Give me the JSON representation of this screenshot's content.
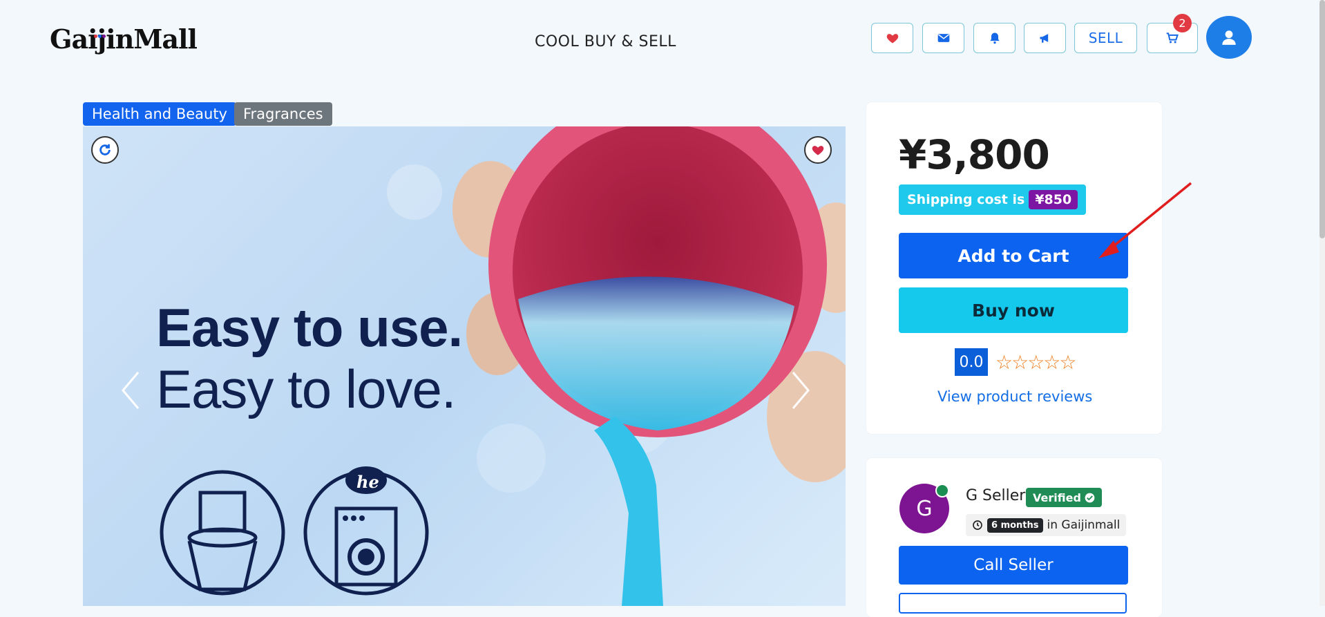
{
  "header": {
    "logo": "GaijinMall",
    "tagline": "COOL BUY & SELL",
    "sell_label": "SELL",
    "cart_count": "2",
    "icons": [
      "heart-icon",
      "envelope-icon",
      "bell-icon",
      "bullhorn-icon",
      "cart-icon",
      "user-icon"
    ]
  },
  "categories": [
    "Health and Beauty",
    "Fragrances"
  ],
  "product_image": {
    "headline_line1": "Easy to use.",
    "headline_line2": "Easy to love.",
    "logo_text": "he"
  },
  "purchase": {
    "price": "¥3,800",
    "shipping_label": "Shipping cost is",
    "shipping_value": "¥850",
    "add_to_cart": "Add to Cart",
    "buy_now": "Buy now",
    "rating": "0.0",
    "stars": "☆☆☆☆☆",
    "reviews_link": "View product reviews"
  },
  "seller": {
    "initial": "G",
    "name": "G Seller",
    "verified": "Verified",
    "duration": "6 months",
    "tenure_suffix": "in Gaijinmall",
    "call_button": "Call Seller"
  },
  "colors": {
    "primary": "#0b63ef",
    "cyan": "#14c9ec",
    "seller_purple": "#7d1592",
    "verified_green": "#1f8b55",
    "badge_red": "#e23a43"
  }
}
